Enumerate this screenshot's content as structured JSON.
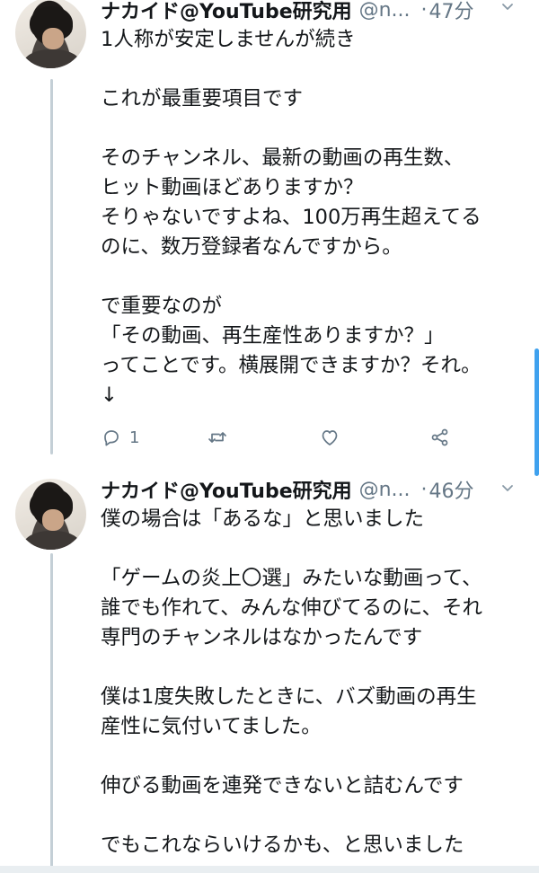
{
  "tweets": [
    {
      "author": "ナカイド@YouTube研究用",
      "handle": "@n...",
      "separator": "·",
      "time": "47分",
      "text": "1人称が安定しませんが続き\n\nこれが最重要項目です\n\nそのチャンネル、最新の動画の再生数、\nヒット動画ほどありますか？\nそりゃないですよね、100万再生超えてる\nのに、数万登録者なんですから。\n\nで重要なのが\n「その動画、再生産性ありますか？」\nってことです。横展開できますか？それ。\n↓",
      "reply_count": "1"
    },
    {
      "author": "ナカイド@YouTube研究用",
      "handle": "@n...",
      "separator": "·",
      "time": "46分",
      "text": "僕の場合は「あるな」と思いました\n\n「ゲームの炎上〇選」みたいな動画って、\n誰でも作れて、みんな伸びてるのに、それ\n専門のチャンネルはなかったんです\n\n僕は1度失敗したときに、バズ動画の再生\n産性に気付いてました。\n\n伸びる動画を連発できないと詰むんです\n\nでもこれならいけるかも、と思いました"
    }
  ],
  "icons": [
    "reply-icon",
    "retweet-icon",
    "like-icon",
    "share-icon",
    "chevron-down-icon"
  ],
  "colors": {
    "text": "#14171a",
    "muted": "#657786",
    "thread_line": "#c4cfd6",
    "accent": "#1da1f2"
  }
}
